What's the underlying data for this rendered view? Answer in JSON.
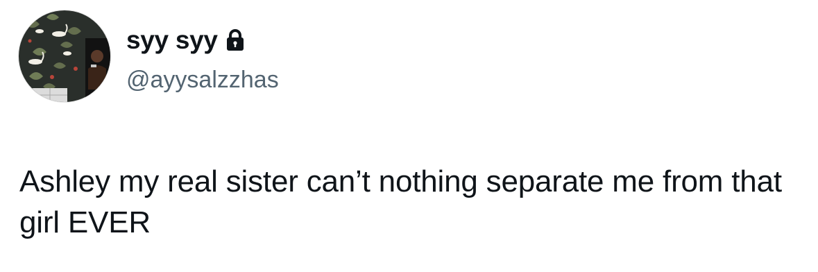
{
  "author": {
    "display_name": "syy syy",
    "handle": "@ayysalzzhas",
    "protected_icon": "lock-icon",
    "avatar_icon": "profile-photo"
  },
  "tweet": {
    "text": "Ashley my real sister can’t nothing separate me from that girl EVER"
  },
  "colors": {
    "text_primary": "#0f1419",
    "text_secondary": "#536471",
    "background": "#ffffff"
  }
}
